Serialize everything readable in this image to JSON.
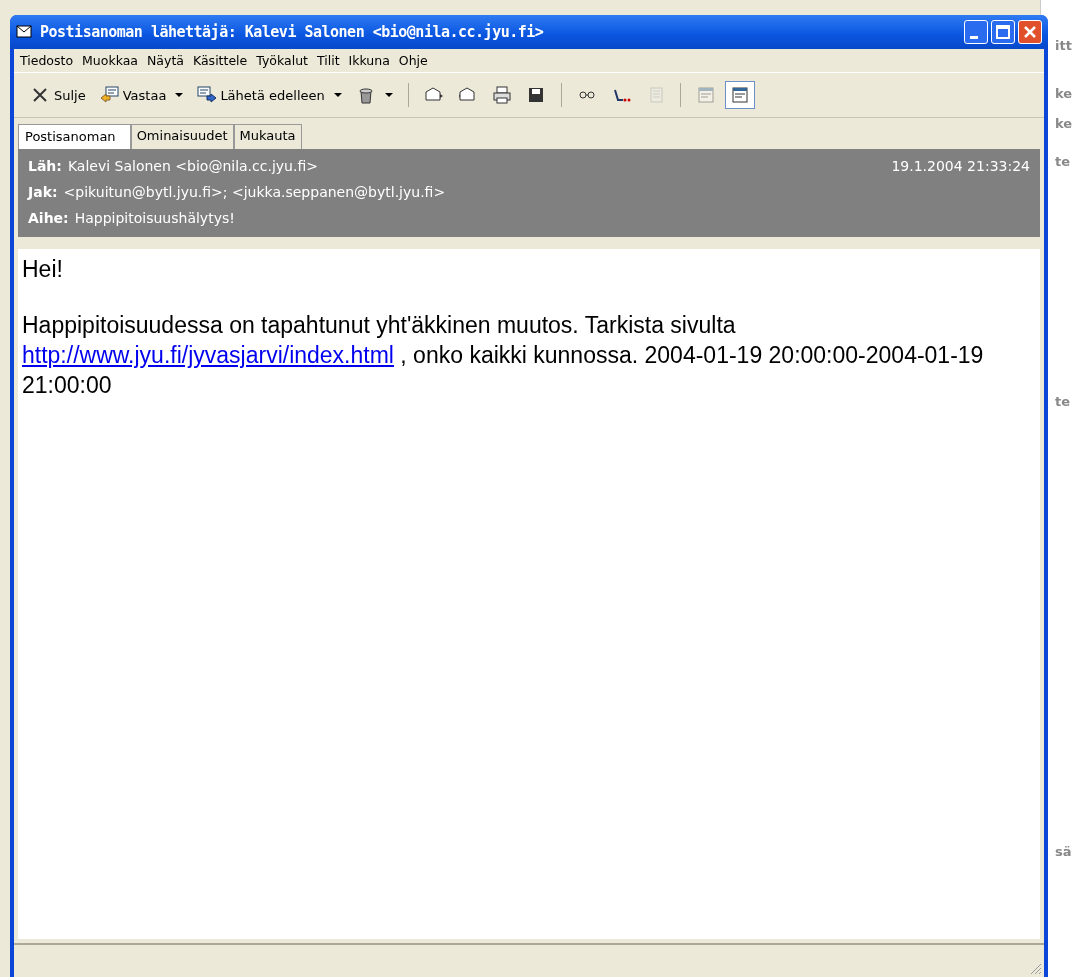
{
  "window": {
    "title": "Postisanoman lähettäjä: Kalevi Salonen <bio@nila.cc.jyu.fi>"
  },
  "menu": [
    "Tiedosto",
    "Muokkaa",
    "Näytä",
    "Käsittele",
    "Työkalut",
    "Tilit",
    "Ikkuna",
    "Ohje"
  ],
  "toolbar": [
    {
      "kind": "button",
      "label": "Sulje",
      "dropdown": false,
      "disabled": false,
      "pressed": false
    },
    {
      "kind": "button",
      "label": "Vastaa",
      "dropdown": true,
      "disabled": false,
      "pressed": false
    },
    {
      "kind": "button",
      "label": "Lähetä edelleen",
      "dropdown": true,
      "disabled": false,
      "pressed": false
    },
    {
      "kind": "button",
      "dropdown": true,
      "disabled": false,
      "pressed": false
    },
    {
      "kind": "separator"
    },
    {
      "kind": "button",
      "dropdown": false,
      "disabled": false,
      "pressed": false
    },
    {
      "kind": "button",
      "dropdown": false,
      "disabled": false,
      "pressed": false
    },
    {
      "kind": "button",
      "dropdown": false,
      "disabled": false,
      "pressed": false
    },
    {
      "kind": "button",
      "dropdown": false,
      "disabled": false,
      "pressed": false
    },
    {
      "kind": "separator"
    },
    {
      "kind": "button",
      "dropdown": false,
      "disabled": false,
      "pressed": false
    },
    {
      "kind": "button",
      "dropdown": false,
      "disabled": false,
      "pressed": false
    },
    {
      "kind": "button",
      "dropdown": false,
      "disabled": true,
      "pressed": false
    },
    {
      "kind": "separator"
    },
    {
      "kind": "button",
      "dropdown": false,
      "disabled": true,
      "pressed": false
    },
    {
      "kind": "button",
      "dropdown": false,
      "disabled": false,
      "pressed": true
    }
  ],
  "tabs": [
    {
      "label": "Postisanoman",
      "selected": true
    },
    {
      "label": "Ominaisuudet",
      "selected": false
    },
    {
      "label": "Mukauta",
      "selected": false
    }
  ],
  "header": {
    "date": "19.1.2004 21:33:24",
    "fields": [
      {
        "label": "Läh:",
        "value": "Kalevi Salonen <bio@nila.cc.jyu.fi>"
      },
      {
        "label": "Jak:",
        "value": "<pikuitun@bytl.jyu.fi>; <jukka.seppanen@bytl.jyu.fi>"
      },
      {
        "label": "Aihe:",
        "value": "Happipitoisuushälytys!"
      }
    ]
  },
  "body": {
    "greeting": "Hei!",
    "text_before": "Happipitoisuudessa on tapahtunut yht'äkkinen muutos. Tarkista sivulta",
    "link": "http://www.jyu.fi/jyvasjarvi/index.html",
    "text_after": ", onko kaikki kunnossa. 2004-01-19 20:00:00-2004-01-19 21:00:00"
  },
  "background_window": {
    "fragments": [
      "itt",
      "ke",
      "ke",
      "te",
      "te",
      "sä"
    ]
  }
}
